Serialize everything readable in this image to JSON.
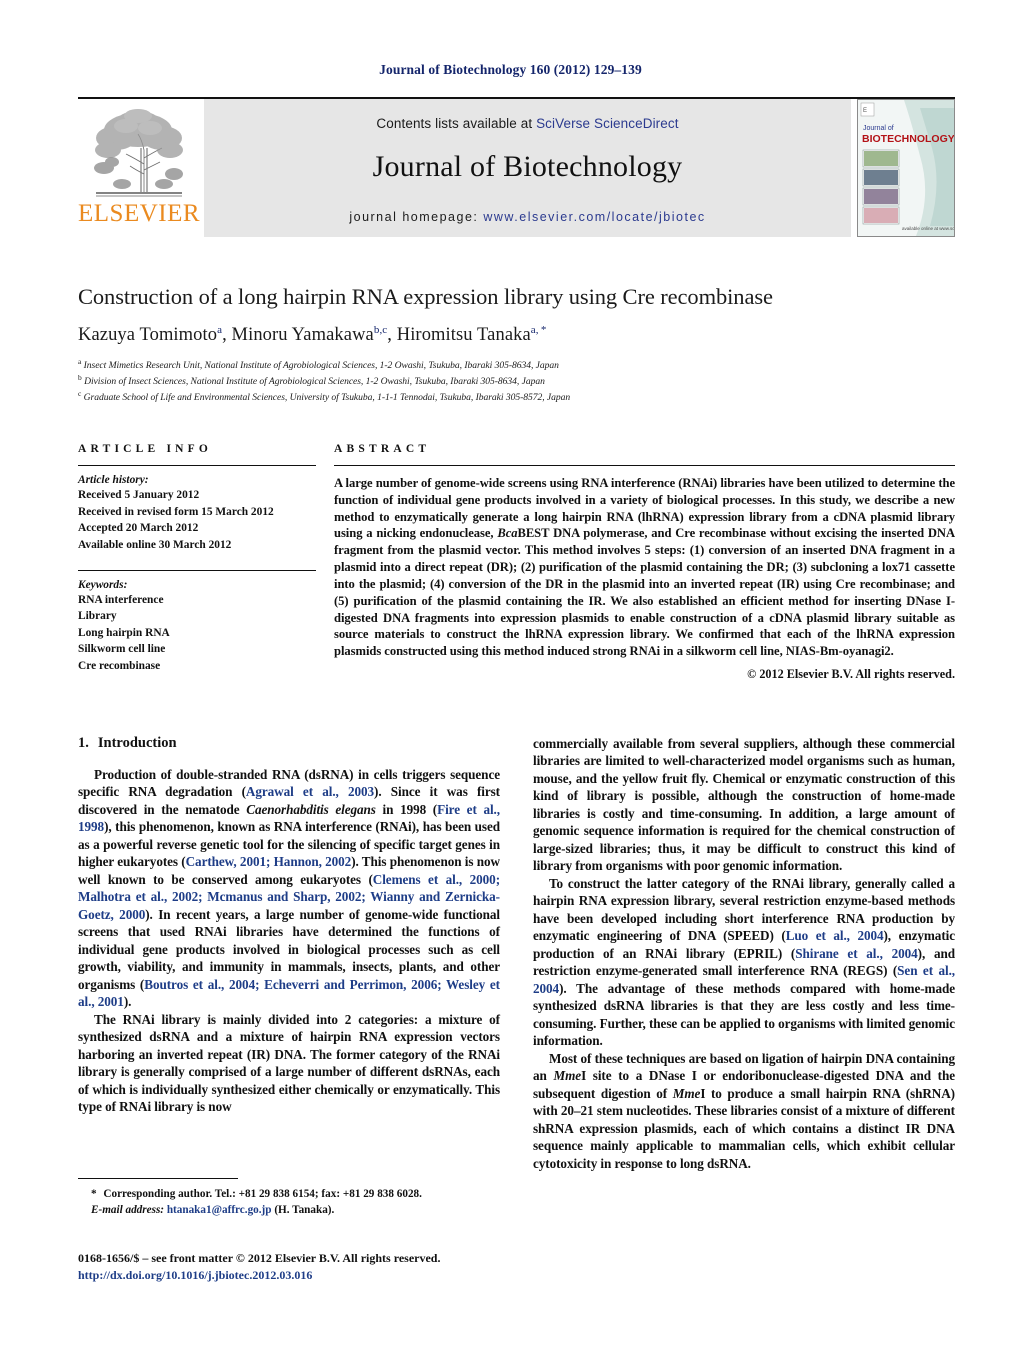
{
  "running_head": "Journal of Biotechnology 160 (2012) 129–139",
  "masthead": {
    "contents_prefix": "Contents lists available at ",
    "sciencedirect": "SciVerse ScienceDirect",
    "journal_title": "Journal of Biotechnology",
    "homepage_label": "journal homepage: ",
    "homepage_url": "www.elsevier.com/locate/jbiotec",
    "publisher_logo_text": "ELSEVIER",
    "cover_line1": "Journal of",
    "cover_line2": "BIOTECHNOLOGY",
    "link_color": "#2b3a8f",
    "elsevier_orange": "#ea8a1f"
  },
  "article": {
    "title": "Construction of a long hairpin RNA expression library using Cre recombinase",
    "authors_html": "Kazuya Tomimoto<sup>a</sup>, Minoru Yamakawa<sup>b,c</sup>, Hiromitsu Tanaka<sup>a, *</sup>",
    "affiliations": [
      "Insect Mimetics Research Unit, National Institute of Agrobiological Sciences, 1-2 Owashi, Tsukuba, Ibaraki 305-8634, Japan",
      "Division of Insect Sciences, National Institute of Agrobiological Sciences, 1-2 Owashi, Tsukuba, Ibaraki 305-8634, Japan",
      "Graduate School of Life and Environmental Sciences, University of Tsukuba, 1-1-1 Tennodai, Tsukuba, Ibaraki 305-8572, Japan"
    ],
    "affil_marks": [
      "a",
      "b",
      "c"
    ]
  },
  "article_info": {
    "heading": "ARTICLE INFO",
    "history_label": "Article history:",
    "history": [
      "Received 5 January 2012",
      "Received in revised form 15 March 2012",
      "Accepted 20 March 2012",
      "Available online 30 March 2012"
    ],
    "keywords_label": "Keywords:",
    "keywords": [
      "RNA interference",
      "Library",
      "Long hairpin RNA",
      "Silkworm cell line",
      "Cre recombinase"
    ]
  },
  "abstract": {
    "heading": "ABSTRACT",
    "text_html": "A large number of genome-wide screens using RNA interference (RNAi) libraries have been utilized to determine the function of individual gene products involved in a variety of biological processes. In this study, we describe a new method to enzymatically generate a long hairpin RNA (lhRNA) expression library from a cDNA plasmid library using a nicking endonuclease, <i>Bca</i>BEST DNA polymerase, and Cre recombinase without excising the inserted DNA fragment from the plasmid vector. This method involves 5 steps: (1) conversion of an inserted DNA fragment in a plasmid into a direct repeat (DR); (2) purification of the plasmid containing the DR; (3) subcloning a lox71 cassette into the plasmid; (4) conversion of the DR in the plasmid into an inverted repeat (IR) using Cre recombinase; and (5) purification of the plasmid containing the IR. We also established an efficient method for inserting DNase I-digested DNA fragments into expression plasmids to enable construction of a cDNA plasmid library suitable as source materials to construct the lhRNA expression library. We confirmed that each of the lhRNA expression plasmids constructed using this method induced strong RNAi in a silkworm cell line, NIAS-Bm-oyanagi2.",
    "copyright": "© 2012 Elsevier B.V. All rights reserved."
  },
  "introduction": {
    "number": "1.",
    "heading": "Introduction",
    "left_paragraphs_html": [
      "Production of double-stranded RNA (dsRNA) in cells triggers sequence specific RNA degradation (<span class=\"cite\">Agrawal et al., 2003</span>). Since it was first discovered in the nematode <span class=\"it\">Caenorhabditis elegans</span> in 1998 (<span class=\"cite\">Fire et al., 1998</span>), this phenomenon, known as RNA interference (RNAi), has been used as a powerful reverse genetic tool for the silencing of specific target genes in higher eukaryotes (<span class=\"cite\">Carthew, 2001; Hannon, 2002</span>). This phenomenon is now well known to be conserved among eukaryotes (<span class=\"cite\">Clemens et al., 2000; Malhotra et al., 2002; Mcmanus and Sharp, 2002; Wianny and Zernicka-Goetz, 2000</span>). In recent years, a large number of genome-wide functional screens that used RNAi libraries have determined the functions of individual gene products involved in biological processes such as cell growth, viability, and immunity in mammals, insects, plants, and other organisms (<span class=\"cite\">Boutros et al., 2004; Echeverri and Perrimon, 2006; Wesley et al., 2001</span>).",
      "The RNAi library is mainly divided into 2 categories: a mixture of synthesized dsRNA and a mixture of hairpin RNA expression vectors harboring an inverted repeat (IR) DNA. The former category of the RNAi library is generally comprised of a large number of different dsRNAs, each of which is individually synthesized either chemically or enzymatically. This type of RNAi library is now"
    ],
    "right_paragraphs_html": [
      "commercially available from several suppliers, although these commercial libraries are limited to well-characterized model organisms such as human, mouse, and the yellow fruit fly. Chemical or enzymatic construction of this kind of library is possible, although the construction of home-made libraries is costly and time-consuming. In addition, a large amount of genomic sequence information is required for the chemical construction of large-sized libraries; thus, it may be difficult to construct this kind of library from organisms with poor genomic information.",
      "To construct the latter category of the RNAi library, generally called a hairpin RNA expression library, several restriction enzyme-based methods have been developed including short interference RNA production by enzymatic engineering of DNA (SPEED) (<span class=\"cite\">Luo et al., 2004</span>), enzymatic production of an RNAi library (EPRIL) (<span class=\"cite\">Shirane et al., 2004</span>), and restriction enzyme-generated small interference RNA (REGS) (<span class=\"cite\">Sen et al., 2004</span>). The advantage of these methods compared with home-made synthesized dsRNA libraries is that they are less costly and less time-consuming. Further, these can be applied to organisms with limited genomic information.",
      "Most of these techniques are based on ligation of hairpin DNA containing an <span class=\"it\">Mme</span>I site to a DNase I or endoribonuclease-digested DNA and the subsequent digestion of <span class=\"it\">Mme</span>I to produce a small hairpin RNA (shRNA) with 20–21 stem nucleotides. These libraries consist of a mixture of different shRNA expression plasmids, each of which contains a distinct IR DNA sequence mainly applicable to mammalian cells, which exhibit cellular cytotoxicity in response to long dsRNA."
    ]
  },
  "footnotes": {
    "corresponding_html": "<span class=\"star\">*</span> Corresponding author. Tel.: +81 29 838 6154; fax: +81 29 838 6028.",
    "email_html": "<span class=\"fn-em\">E-mail address:</span> <span class=\"mail-link\">htanaka1@affrc.go.jp</span> (H. Tanaka)."
  },
  "imprint": {
    "issn_line": "0168-1656/$ – see front matter © 2012 Elsevier B.V. All rights reserved.",
    "doi": "http://dx.doi.org/10.1016/j.jbiotec.2012.03.016"
  }
}
